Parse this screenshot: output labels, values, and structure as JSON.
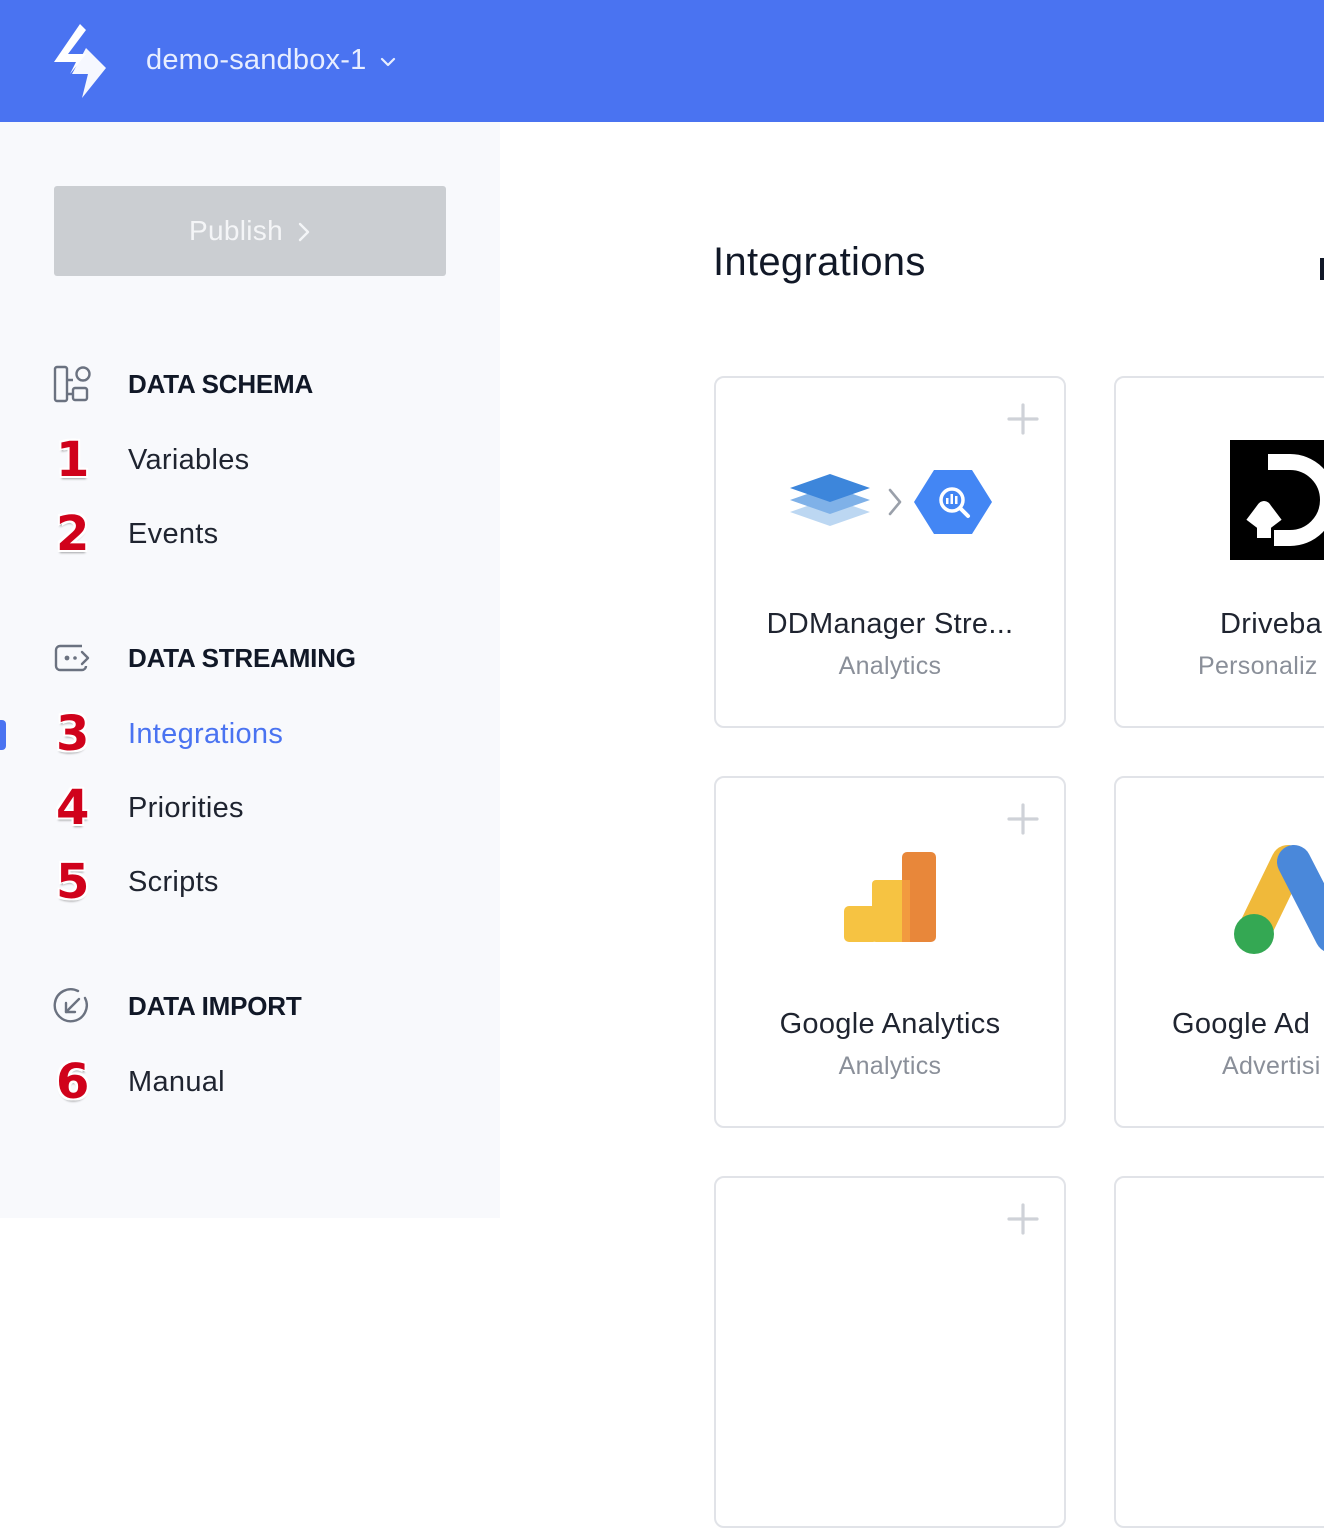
{
  "header": {
    "workspace_name": "demo-sandbox-1",
    "brand_color": "#4a73f1"
  },
  "sidebar": {
    "publish_label": "Publish",
    "sections": [
      {
        "title": "DATA SCHEMA",
        "icon": "data-schema-icon",
        "items": [
          {
            "number": "1",
            "label": "Variables"
          },
          {
            "number": "2",
            "label": "Events"
          }
        ]
      },
      {
        "title": "DATA STREAMING",
        "icon": "data-streaming-icon",
        "items": [
          {
            "number": "3",
            "label": "Integrations",
            "active": true
          },
          {
            "number": "4",
            "label": "Priorities"
          },
          {
            "number": "5",
            "label": "Scripts"
          }
        ]
      },
      {
        "title": "DATA IMPORT",
        "icon": "data-import-icon",
        "items": [
          {
            "number": "6",
            "label": "Manual"
          }
        ]
      }
    ]
  },
  "main": {
    "title": "Integrations",
    "cards": [
      {
        "name": "DDManager Stre...",
        "category": "Analytics",
        "icon": "ddmanager-bigquery-icon",
        "add": true
      },
      {
        "name": "Driveba",
        "category": "Personaliz",
        "icon": "driveback-logo"
      },
      {
        "name": "Google Analytics",
        "category": "Analytics",
        "icon": "google-analytics-icon",
        "add": true
      },
      {
        "name": "Google Ad",
        "category": "Advertisi",
        "icon": "google-ads-icon"
      }
    ]
  }
}
